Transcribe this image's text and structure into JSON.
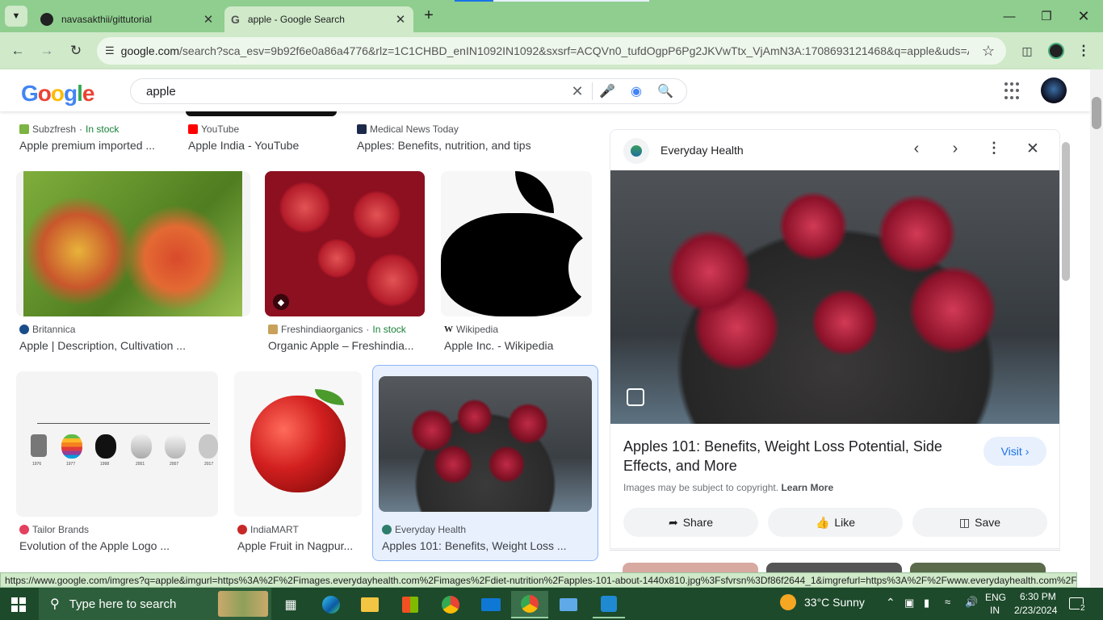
{
  "browser": {
    "tabs": [
      {
        "title": "navasakthii/gittutorial"
      },
      {
        "title": "apple - Google Search"
      }
    ],
    "url_host": "google.com",
    "url_rest": "/search?sca_esv=9b92f6e0a86a4776&rlz=1C1CHBD_enIN1092IN1092&sxsrf=ACQVn0_tufdOgpP6Pg2JKVwTtx_VjAmN3A:1708693121468&q=apple&uds=A..."
  },
  "search": {
    "query": "apple"
  },
  "top_row": [
    {
      "source": "Subzfresh",
      "stock": "In stock",
      "title": "Apple premium imported ..."
    },
    {
      "source": "YouTube",
      "title": "Apple India - YouTube"
    },
    {
      "source": "Medical News Today",
      "title": "Apples: Benefits, nutrition, and tips"
    }
  ],
  "results": [
    {
      "source": "Britannica",
      "title": "Apple | Description, Cultivation ..."
    },
    {
      "source": "Freshindiaorganics",
      "stock": "In stock",
      "title": "Organic Apple – Freshindia..."
    },
    {
      "source": "Wikipedia",
      "title": "Apple Inc. - Wikipedia"
    },
    {
      "source": "Tailor Brands",
      "title": "Evolution of the Apple Logo ..."
    },
    {
      "source": "IndiaMART",
      "title": "Apple Fruit in Nagpur..."
    },
    {
      "source": "Everyday Health",
      "title": "Apples 101: Benefits, Weight Loss ..."
    }
  ],
  "logo_years": [
    "1976",
    "1977",
    "1998",
    "2001",
    "2007",
    "2017"
  ],
  "panel": {
    "source": "Everyday Health",
    "title": "Apples 101: Benefits, Weight Loss Potential, Side Effects, and More",
    "visit": "Visit",
    "copyright": "Images may be subject to copyright.",
    "learn_more": "Learn More",
    "share": "Share",
    "like": "Like",
    "save": "Save"
  },
  "status_url": "https://www.google.com/imgres?q=apple&imgurl=https%3A%2F%2Fimages.everydayhealth.com%2Fimages%2Fdiet-nutrition%2Fapples-101-about-1440x810.jpg%3Fsfvrsn%3Df86f2644_1&imgrefurl=https%3A%2F%2Fwww.everydayhealth.com%2F...",
  "taskbar": {
    "search_placeholder": "Type here to search",
    "weather": "33°C  Sunny",
    "lang1": "ENG",
    "lang2": "IN",
    "time": "6:30 PM",
    "date": "2/23/2024",
    "notifications": "2"
  },
  "colors": {
    "tab_strip": "#8fce8f",
    "toolbar": "#cfe9c9",
    "taskbar": "#1d4a2b",
    "link_blue": "#1a73e8"
  }
}
